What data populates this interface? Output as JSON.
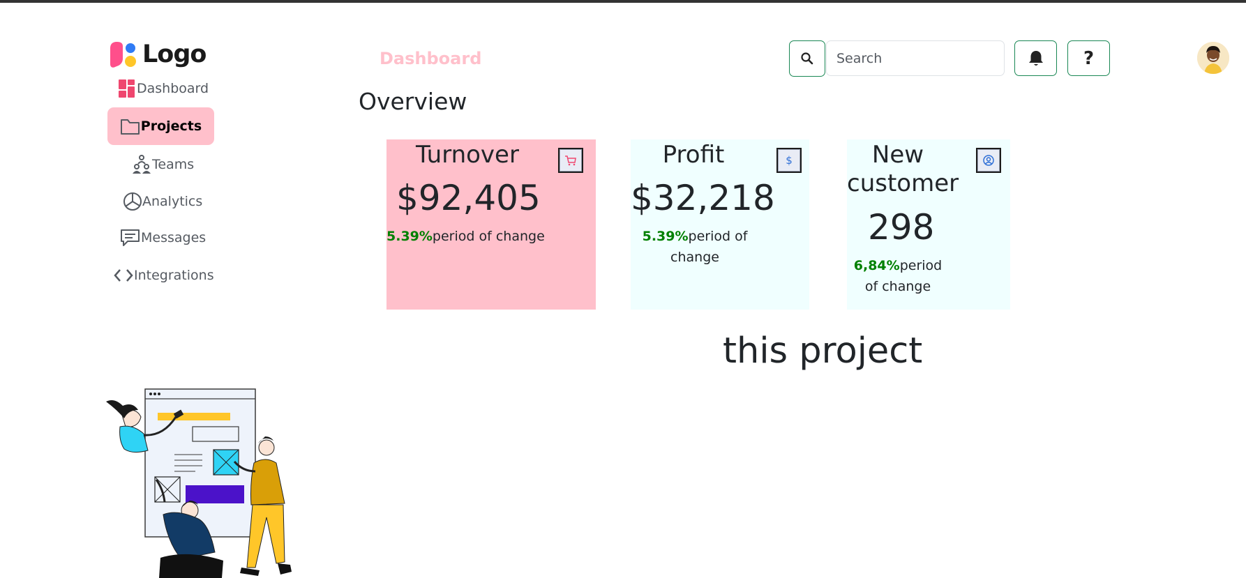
{
  "sidebar": {
    "logo_text": "Logo",
    "items": [
      {
        "label": "Dashboard",
        "icon": "dashboard-grid-icon"
      },
      {
        "label": "Projects",
        "icon": "folder-icon",
        "active": true
      },
      {
        "label": "Teams",
        "icon": "teams-icon"
      },
      {
        "label": "Analytics",
        "icon": "pie-chart-icon"
      },
      {
        "label": "Messages",
        "icon": "message-icon"
      },
      {
        "label": "Integrations",
        "icon": "code-icon"
      }
    ]
  },
  "header": {
    "title": "Dashboard",
    "search_placeholder": "Search",
    "help_label": "?",
    "icons": [
      "search-icon",
      "bell-icon",
      "avatar"
    ]
  },
  "main": {
    "heading": "Overview",
    "cards": [
      {
        "title": "Turnover",
        "value": "$92,405",
        "change_pct": "5.39%",
        "change_text": "period of change",
        "icon": "cart-icon",
        "color": "#ffc0cb"
      },
      {
        "title": "Profit",
        "value": "$32,218",
        "change_pct": "5.39%",
        "change_text": "period of change",
        "icon": "dollar-icon",
        "color": "#f0ffff"
      },
      {
        "title": "New customer",
        "value": "298",
        "change_pct": "6,84%",
        "change_text": "period of change",
        "icon": "user-circle-icon",
        "color": "#f0ffff"
      }
    ],
    "footer_text": "this project"
  },
  "colors": {
    "accent_pink": "#ffc0cb",
    "success_green": "#008000",
    "button_border": "#198754",
    "light_cyan": "#f0ffff"
  }
}
